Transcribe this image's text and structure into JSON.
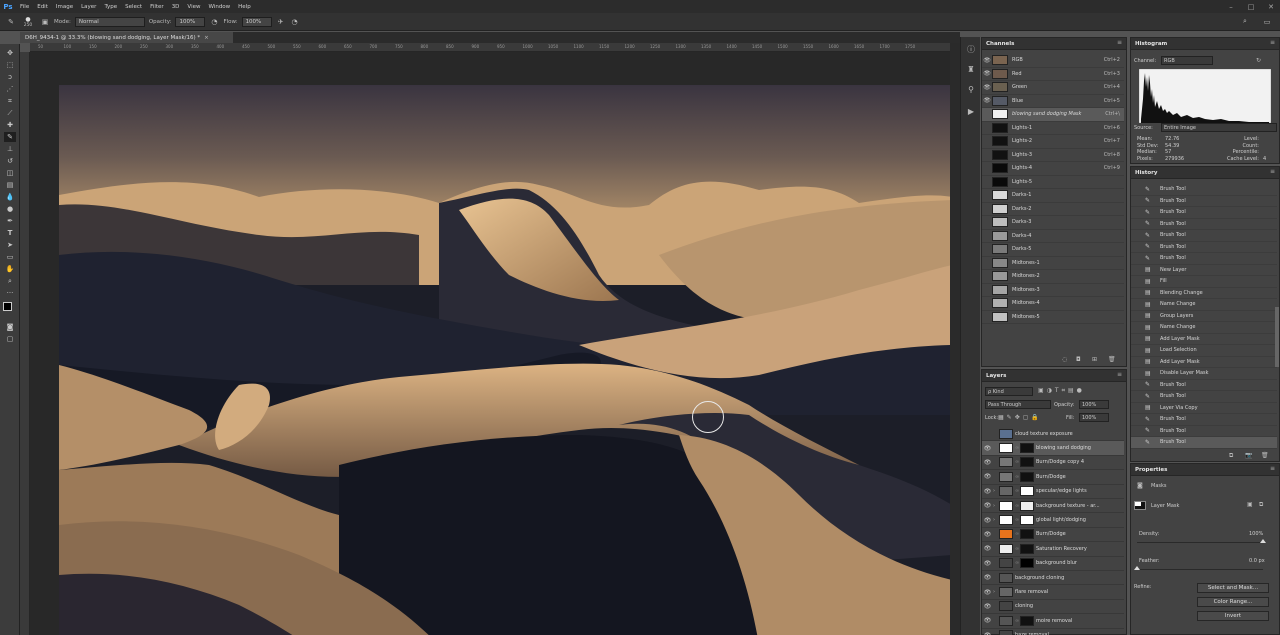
{
  "menubar": {
    "logo": "Ps",
    "items": [
      "File",
      "Edit",
      "Image",
      "Layer",
      "Type",
      "Select",
      "Filter",
      "3D",
      "View",
      "Window",
      "Help"
    ],
    "controls": {
      "minimize": "–",
      "maximize": "□",
      "close": "✕"
    }
  },
  "options": {
    "brush_size": "250",
    "mode_label": "Mode:",
    "mode_value": "Normal",
    "opacity_label": "Opacity:",
    "opacity_value": "100%",
    "flow_label": "Flow:",
    "flow_value": "100%"
  },
  "document": {
    "tab_title": "D6H_9434-1 @ 33.3% (blowing sand dodging, Layer Mask/16) *",
    "tab_close": "×",
    "ruler_ticks": [
      "50",
      "100",
      "150",
      "200",
      "250",
      "300",
      "350",
      "400",
      "450",
      "500",
      "550",
      "600",
      "650",
      "700",
      "750",
      "800",
      "850",
      "900",
      "950",
      "1000",
      "1050",
      "1100",
      "1150",
      "1200",
      "1250",
      "1300",
      "1350",
      "1400",
      "1450",
      "1500",
      "1550",
      "1600",
      "1650",
      "1700",
      "1750"
    ]
  },
  "channels": {
    "title": "Channels",
    "rows": [
      {
        "name": "RGB",
        "key": "Ctrl+2",
        "eye": "👁"
      },
      {
        "name": "Red",
        "key": "Ctrl+3",
        "eye": "👁"
      },
      {
        "name": "Green",
        "key": "Ctrl+4",
        "eye": "👁"
      },
      {
        "name": "Blue",
        "key": "Ctrl+5",
        "eye": "👁"
      },
      {
        "name": "blowing sand dodging Mask",
        "key": "Ctrl+\\",
        "eye": ""
      },
      {
        "name": "Lights-1",
        "key": "Ctrl+6",
        "eye": ""
      },
      {
        "name": "Lights-2",
        "key": "Ctrl+7",
        "eye": ""
      },
      {
        "name": "Lights-3",
        "key": "Ctrl+8",
        "eye": ""
      },
      {
        "name": "Lights-4",
        "key": "Ctrl+9",
        "eye": ""
      },
      {
        "name": "Lights-5",
        "key": "",
        "eye": ""
      },
      {
        "name": "Darks-1",
        "key": "",
        "eye": ""
      },
      {
        "name": "Darks-2",
        "key": "",
        "eye": ""
      },
      {
        "name": "Darks-3",
        "key": "",
        "eye": ""
      },
      {
        "name": "Darks-4",
        "key": "",
        "eye": ""
      },
      {
        "name": "Darks-5",
        "key": "",
        "eye": ""
      },
      {
        "name": "Midtones-1",
        "key": "",
        "eye": ""
      },
      {
        "name": "Midtones-2",
        "key": "",
        "eye": ""
      },
      {
        "name": "Midtones-3",
        "key": "",
        "eye": ""
      },
      {
        "name": "Midtones-4",
        "key": "",
        "eye": ""
      },
      {
        "name": "Midtones-5",
        "key": "",
        "eye": ""
      }
    ]
  },
  "histogram": {
    "title": "Histogram",
    "channel_label": "Channel:",
    "channel_value": "RGB",
    "source_label": "Source:",
    "source_value": "Entire Image",
    "stats_left": [
      {
        "label": "Mean:",
        "value": "72.76"
      },
      {
        "label": "Std Dev:",
        "value": "54.39"
      },
      {
        "label": "Median:",
        "value": "57"
      },
      {
        "label": "Pixels:",
        "value": "279936"
      }
    ],
    "stats_right": [
      {
        "label": "Level:",
        "value": ""
      },
      {
        "label": "Count:",
        "value": ""
      },
      {
        "label": "Percentile:",
        "value": ""
      },
      {
        "label": "Cache Level:",
        "value": "4"
      }
    ]
  },
  "history": {
    "title": "History",
    "rows": [
      "Brush Tool",
      "Brush Tool",
      "Brush Tool",
      "Brush Tool",
      "Brush Tool",
      "Brush Tool",
      "Brush Tool",
      "New Layer",
      "Fill",
      "Blending Change",
      "Name Change",
      "Group Layers",
      "Name Change",
      "Add Layer Mask",
      "Load Selection",
      "Add Layer Mask",
      "Disable Layer Mask",
      "Brush Tool",
      "Brush Tool",
      "Layer Via Copy",
      "Brush Tool",
      "Brush Tool",
      "Brush Tool"
    ]
  },
  "layers": {
    "title": "Layers",
    "kind_value": "ρ Kind",
    "blend_value": "Pass Through",
    "opacity_label": "Opacity:",
    "opacity_value": "100%",
    "lock_label": "Lock:",
    "fill_label": "Fill:",
    "fill_value": "100%",
    "rows": [
      {
        "name": "cloud texture exposure",
        "eye": "",
        "arrow": ""
      },
      {
        "name": "blowing sand dodging",
        "eye": "👁",
        "arrow": ""
      },
      {
        "name": "Burn/Dodge copy 4",
        "eye": "👁",
        "arrow": ""
      },
      {
        "name": "Burn/Dodge",
        "eye": "👁",
        "arrow": ""
      },
      {
        "name": "specular/edge lights",
        "eye": "👁",
        "arrow": "›"
      },
      {
        "name": "background texture - ar...",
        "eye": "👁",
        "arrow": "›"
      },
      {
        "name": "global light/dodging",
        "eye": "👁",
        "arrow": "›"
      },
      {
        "name": "Burn/Dodge",
        "eye": "👁",
        "arrow": ""
      },
      {
        "name": "Saturation Recovery",
        "eye": "👁",
        "arrow": ""
      },
      {
        "name": "background blur",
        "eye": "👁",
        "arrow": ""
      },
      {
        "name": "background cloning",
        "eye": "👁",
        "arrow": ""
      },
      {
        "name": "flare removal",
        "eye": "👁",
        "arrow": "›"
      },
      {
        "name": "cloning",
        "eye": "👁",
        "arrow": ""
      },
      {
        "name": "moire removal",
        "eye": "👁",
        "arrow": ""
      },
      {
        "name": "haze removal",
        "eye": "👁",
        "arrow": ""
      }
    ]
  },
  "properties": {
    "title": "Properties",
    "section": "Masks",
    "mask_label": "Layer Mask",
    "density_label": "Density:",
    "density_value": "100%",
    "density_level": 1.0,
    "feather_label": "Feather:",
    "feather_value": "0.0 px",
    "feather_level": 0.0,
    "refine_label": "Refine:",
    "buttons": [
      "Select and Mask...",
      "Color Range...",
      "Invert"
    ]
  },
  "colors": {
    "accent": "#4aa3ff",
    "orange_layer": "#e8731c",
    "selected_row": "#5a5a5a"
  }
}
